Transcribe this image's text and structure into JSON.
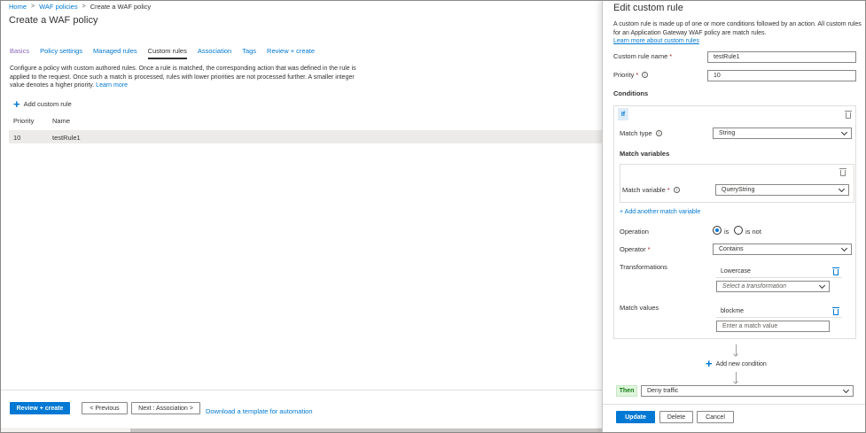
{
  "breadcrumb": [
    "Home",
    "WAF policies",
    "Create a WAF policy"
  ],
  "page_title": "Create a WAF policy",
  "tabs": [
    "Basics",
    "Policy settings",
    "Managed rules",
    "Custom rules",
    "Association",
    "Tags",
    "Review + create"
  ],
  "description": "Configure a policy with custom authored rules. Once a rule is matched, the corresponding action that was defined in the rule is applied to the request. Once such a match is processed, rules with lower priorities are not processed further. A smaller integer value denotes a higher priority.",
  "learn_more": "Learn more",
  "add_custom_rule": "Add custom rule",
  "table": {
    "headers": [
      "Priority",
      "Name"
    ],
    "rows": [
      {
        "priority": "10",
        "name": "testRule1"
      }
    ]
  },
  "footer": {
    "review_create": "Review + create",
    "previous": "< Previous",
    "next": "Next : Association >",
    "download_template": "Download a template for automation"
  },
  "panel": {
    "title": "Edit custom rule",
    "description": "A custom rule is made up of one or more conditions followed by an action. All custom rules for an Application Gateway WAF policy are match rules.",
    "learn_more": "Learn more about custom rules",
    "rule_name_label": "Custom rule name",
    "rule_name_value": "testRule1",
    "priority_label": "Priority",
    "priority_value": "10",
    "conditions_heading": "Conditions",
    "if_label": "If",
    "match_type_label": "Match type",
    "match_type_value": "String",
    "match_variables_heading": "Match variables",
    "match_variable_label": "Match variable",
    "match_variable_value": "QueryString",
    "add_match_variable": "+ Add another match variable",
    "operation_label": "Operation",
    "operation_is": "is",
    "operation_is_not": "is not",
    "operator_label": "Operator",
    "operator_value": "Contains",
    "transformations_label": "Transformations",
    "transformation_value": "Lowercase",
    "transformation_placeholder": "Select a transformation",
    "match_values_label": "Match values",
    "match_value": "blockme",
    "match_value_placeholder": "Enter a match value",
    "add_new_condition": "Add new condition",
    "then_label": "Then",
    "action_value": "Deny traffic",
    "update": "Update",
    "delete": "Delete",
    "cancel": "Cancel"
  },
  "icons": {
    "add": "plus-icon",
    "info": "info-icon",
    "delete": "trash-icon",
    "dropdown": "chevron-down-icon"
  },
  "colors": {
    "accent": "#0078d4",
    "required": "#a4262c",
    "then_badge": "#107c10"
  }
}
